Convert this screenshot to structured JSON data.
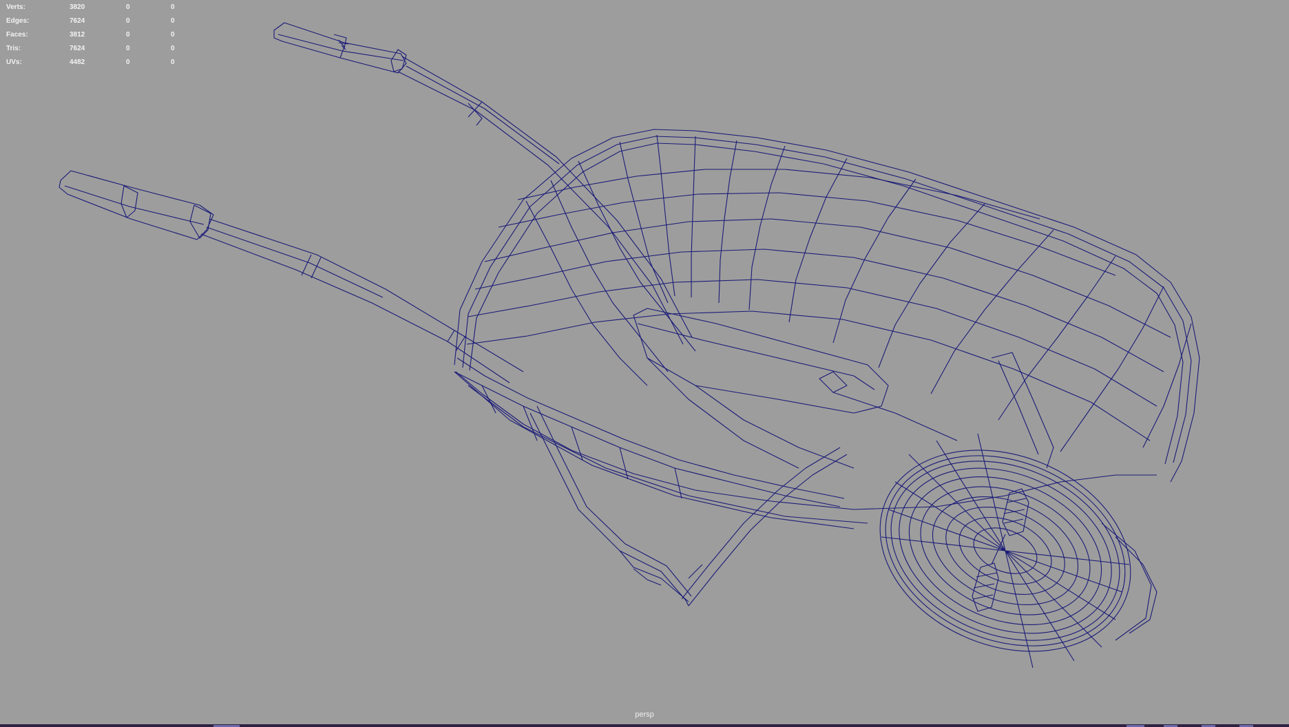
{
  "hud": {
    "rows": [
      {
        "label": "Verts:",
        "v1": "3820",
        "v2": "0",
        "v3": "0"
      },
      {
        "label": "Edges:",
        "v1": "7624",
        "v2": "0",
        "v3": "0"
      },
      {
        "label": "Faces:",
        "v1": "3812",
        "v2": "0",
        "v3": "0"
      },
      {
        "label": "Tris:",
        "v1": "7624",
        "v2": "0",
        "v3": "0"
      },
      {
        "label": "UVs:",
        "v1": "4482",
        "v2": "0",
        "v3": "0"
      }
    ]
  },
  "viewport": {
    "camera": "persp",
    "background_color": "#9d9d9d",
    "wireframe_color": "#1a1a78"
  }
}
